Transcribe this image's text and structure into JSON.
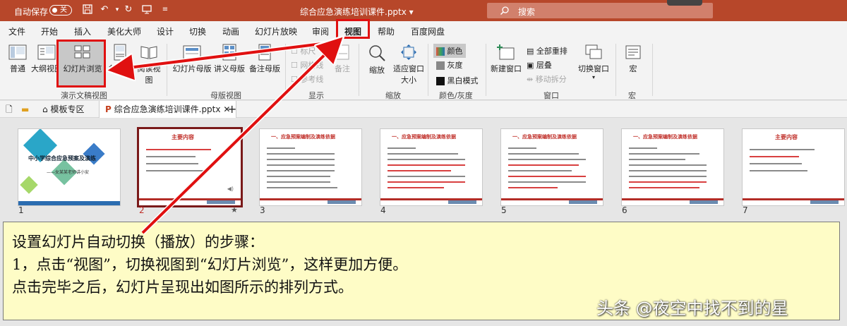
{
  "titlebar": {
    "autosave_label": "自动保存",
    "autosave_state": "关",
    "document_title": "综合应急演练培训课件.pptx",
    "search_placeholder": "搜索"
  },
  "tabs": [
    "文件",
    "开始",
    "插入",
    "美化大师",
    "设计",
    "切换",
    "动画",
    "幻灯片放映",
    "审阅",
    "视图",
    "帮助",
    "百度网盘"
  ],
  "active_tab": "视图",
  "ribbon": {
    "presentation_views": {
      "label": "演示文稿视图",
      "buttons": [
        "普通",
        "大纲视图",
        "幻灯片浏览",
        "备注页",
        "阅读视图"
      ]
    },
    "master_views": {
      "label": "母版视图",
      "buttons": [
        "幻灯片母版",
        "讲义母版",
        "备注母版"
      ]
    },
    "show": {
      "label": "显示",
      "items": [
        "标尺",
        "网格线",
        "参考线"
      ],
      "notes": "备注"
    },
    "zoom": {
      "label": "缩放",
      "zoom": "缩放",
      "fit": "适应窗口大小"
    },
    "color": {
      "label": "颜色/灰度",
      "items": [
        "颜色",
        "灰度",
        "黑白模式"
      ]
    },
    "window": {
      "label": "窗口",
      "new_window": "新建窗口",
      "items": [
        "全部重排",
        "层叠",
        "移动拆分"
      ],
      "switch": "切换窗口"
    },
    "macro": {
      "label": "宏",
      "button": "宏"
    }
  },
  "doc_tabs": {
    "template_zone": "模板专区",
    "current": "综合应急演练培训课件.pptx"
  },
  "slides": [
    {
      "num": "1",
      "title": "中小学综合应急预案及演练",
      "subtitle": "——女某某老师讲小安"
    },
    {
      "num": "2",
      "title": "主要内容"
    },
    {
      "num": "3",
      "title": "一、应急预案编制及演练依据"
    },
    {
      "num": "4",
      "title": "一、应急预案编制及演练依据"
    },
    {
      "num": "5",
      "title": "一、应急预案编制及演练依据"
    },
    {
      "num": "6",
      "title": "一、应急预案编制及演练依据"
    },
    {
      "num": "7",
      "title": "主要内容"
    }
  ],
  "annotation": {
    "line1": "设置幻灯片自动切换（播放）的步骤：",
    "line2": "1，点击“视图”，切换视图到“幻灯片浏览”，这样更加方便。",
    "line3": "点击完毕之后，幻灯片呈现出如图所示的排列方式。"
  },
  "watermark": "头条 @夜空中找不到的星",
  "colors": {
    "title_bar": "#b7472a",
    "highlight_red": "#e01010",
    "note_bg": "#fefcc6"
  }
}
